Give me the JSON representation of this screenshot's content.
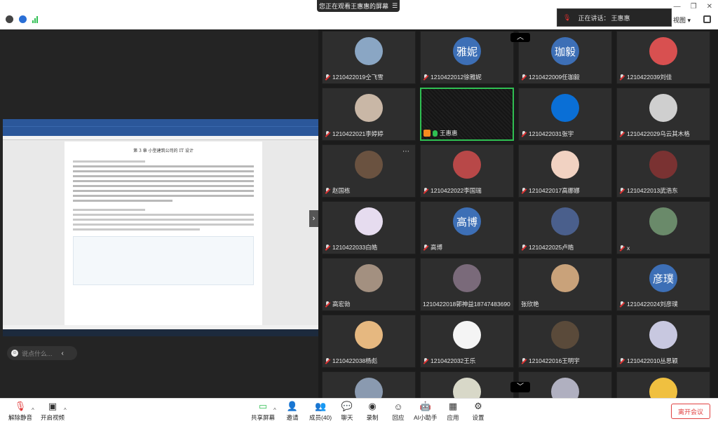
{
  "top_banner": "您正在观看王惠惠的屏幕",
  "speaking": {
    "label": "正在讲话：",
    "name": "王惠惠"
  },
  "view_button": "视图",
  "chat": {
    "placeholder": "说点什么..."
  },
  "doc": {
    "heading": "第 3 章  小型建筑公司的 IT 设计"
  },
  "participants": [
    {
      "name": "1210422019仝飞雪",
      "avatar": "photo",
      "color": "#8aa6c4"
    },
    {
      "name": "1210422012徐雅妮",
      "avatar": "text",
      "text": "雅妮",
      "color": "#3d6fb6"
    },
    {
      "name": "1210422009任珈毅",
      "avatar": "text",
      "text": "珈毅",
      "color": "#3d6fb6"
    },
    {
      "name": "1210422039刘佳",
      "avatar": "photo",
      "color": "#d85050"
    },
    {
      "name": "1210422021李婷婷",
      "avatar": "photo",
      "color": "#c9b7a6"
    },
    {
      "name": "王惠惠",
      "avatar": "video",
      "color": "#111111"
    },
    {
      "name": "1210422031张宇",
      "avatar": "photo",
      "color": "#0a6fd6"
    },
    {
      "name": "1210422029乌云其木格",
      "avatar": "photo",
      "color": "#cfcfcf"
    },
    {
      "name": "赵国栋",
      "avatar": "photo",
      "color": "#6a5240"
    },
    {
      "name": "1210422022李国瑞",
      "avatar": "photo",
      "color": "#b84848"
    },
    {
      "name": "1210422017高娜娜",
      "avatar": "photo",
      "color": "#f1d2c2"
    },
    {
      "name": "1210422013武浩东",
      "avatar": "photo",
      "color": "#7a3232"
    },
    {
      "name": "1210422033白皓",
      "avatar": "photo",
      "color": "#e6dcef"
    },
    {
      "name": "高博",
      "avatar": "text",
      "text": "高博",
      "color": "#3d6fb6"
    },
    {
      "name": "1210422025卢皓",
      "avatar": "photo",
      "color": "#4a5f8c"
    },
    {
      "name": "x",
      "avatar": "photo",
      "color": "#6a8a6a"
    },
    {
      "name": "高宏勃",
      "avatar": "photo",
      "color": "#a39080"
    },
    {
      "name": "1210422018郭神益18747483690",
      "avatar": "photo",
      "color": "#7a6a7a"
    },
    {
      "name": "张欣艳",
      "avatar": "photo",
      "color": "#c9a27a"
    },
    {
      "name": "1210422024刘彦璞",
      "avatar": "text",
      "text": "彦璞",
      "color": "#3d6fb6"
    },
    {
      "name": "1210422038杨彪",
      "avatar": "photo",
      "color": "#e6b880"
    },
    {
      "name": "1210422032王乐",
      "avatar": "photo",
      "color": "#f4f4f4"
    },
    {
      "name": "1210422016王明宇",
      "avatar": "photo",
      "color": "#5a4a3a"
    },
    {
      "name": "1210422010丛思颖",
      "avatar": "photo",
      "color": "#c8c8e0"
    },
    {
      "name": "",
      "avatar": "photo",
      "color": "#8a9ab0"
    },
    {
      "name": "",
      "avatar": "photo",
      "color": "#d8d8c8"
    },
    {
      "name": "",
      "avatar": "photo",
      "color": "#b0b0c0"
    },
    {
      "name": "",
      "avatar": "photo",
      "color": "#f0c040"
    }
  ],
  "toolbar": {
    "unmute": "解除静音",
    "start_video": "开启视频",
    "share_screen": "共享屏幕",
    "invite": "邀请",
    "members": "成员(40)",
    "chat": "聊天",
    "record": "录制",
    "reactions": "回应",
    "ai_assistant": "AI小助手",
    "apps": "应用",
    "settings": "设置",
    "leave": "离开会议"
  },
  "colors": {
    "accent": "#2fbf52",
    "danger": "#e04040",
    "host": "#f58a1f"
  }
}
